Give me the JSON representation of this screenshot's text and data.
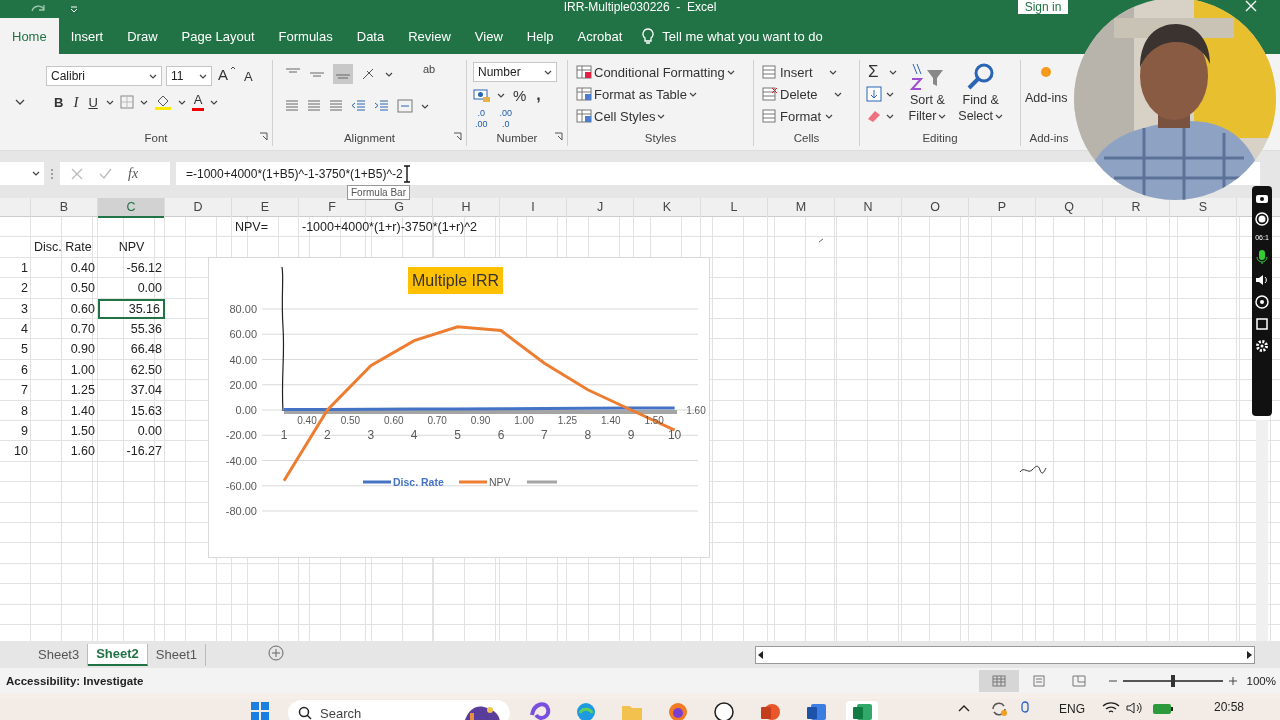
{
  "window": {
    "title": "IRR-Multiple030226  -  Excel",
    "sign_in": "Sign in"
  },
  "ribbon_tabs": [
    {
      "label": "Home",
      "selected": true
    },
    {
      "label": "Insert",
      "selected": false
    },
    {
      "label": "Draw",
      "selected": false
    },
    {
      "label": "Page Layout",
      "selected": false
    },
    {
      "label": "Formulas",
      "selected": false
    },
    {
      "label": "Data",
      "selected": false
    },
    {
      "label": "Review",
      "selected": false
    },
    {
      "label": "View",
      "selected": false
    },
    {
      "label": "Help",
      "selected": false
    },
    {
      "label": "Acrobat",
      "selected": false
    }
  ],
  "tell_me": "Tell me what you want to do",
  "ribbon": {
    "font_family": "Calibri",
    "font_size": "11",
    "grow_font": "A",
    "shrink_font": "A",
    "bold": "B",
    "italic": "I",
    "underline": "U",
    "font_color": "A",
    "wrap_text": "ab",
    "number_format": "Number",
    "percent": "%",
    "comma": ",",
    "increase_decimal": [
      ".0",
      ".00"
    ],
    "decrease_decimal": [
      ".00",
      ".0"
    ],
    "styles": [
      "Conditional Formatting",
      "Format as Table",
      "Cell Styles"
    ],
    "cells": [
      "Insert",
      "Delete",
      "Format"
    ],
    "sum": "Σ",
    "sort_filter": [
      "Sort &",
      "Filter"
    ],
    "find_select": [
      "Find &",
      "Select"
    ],
    "add_ins": "Add-ins",
    "group_labels": [
      "Font",
      "Alignment",
      "Number",
      "Styles",
      "Cells",
      "Editing",
      "Add-ins"
    ]
  },
  "formula_bar": {
    "fx": "fx",
    "formula": "=-1000+4000*(1+B5)^-1-3750*(1+B5)^-2",
    "tooltip": "Formula Bar"
  },
  "columns": [
    {
      "label": "B",
      "selected": false
    },
    {
      "label": "C",
      "selected": true
    },
    {
      "label": "D",
      "selected": false
    },
    {
      "label": "E",
      "selected": false
    },
    {
      "label": "F",
      "selected": false
    },
    {
      "label": "G",
      "selected": false
    },
    {
      "label": "H",
      "selected": false
    },
    {
      "label": "I",
      "selected": false
    },
    {
      "label": "J",
      "selected": false
    },
    {
      "label": "K",
      "selected": false
    },
    {
      "label": "L",
      "selected": false
    },
    {
      "label": "M",
      "selected": false
    },
    {
      "label": "N",
      "selected": false
    },
    {
      "label": "O",
      "selected": false
    },
    {
      "label": "P",
      "selected": false
    },
    {
      "label": "Q",
      "selected": false
    },
    {
      "label": "R",
      "selected": false
    },
    {
      "label": "S",
      "selected": false
    }
  ],
  "sheet": {
    "npv_label": "NPV=",
    "npv_formula": "-1000+4000*(1+r)-3750*(1+r)^2",
    "headers": [
      "Disc. Rate",
      "NPV"
    ],
    "rows": [
      {
        "n": "1",
        "rate": "0.40",
        "npv": "-56.12",
        "selected": false
      },
      {
        "n": "2",
        "rate": "0.50",
        "npv": "0.00",
        "selected": false
      },
      {
        "n": "3",
        "rate": "0.60",
        "npv": "35.16",
        "selected": true
      },
      {
        "n": "4",
        "rate": "0.70",
        "npv": "55.36",
        "selected": false
      },
      {
        "n": "5",
        "rate": "0.90",
        "npv": "66.48",
        "selected": false
      },
      {
        "n": "6",
        "rate": "1.00",
        "npv": "62.50",
        "selected": false
      },
      {
        "n": "7",
        "rate": "1.25",
        "npv": "37.04",
        "selected": false
      },
      {
        "n": "8",
        "rate": "1.40",
        "npv": "15.63",
        "selected": false
      },
      {
        "n": "9",
        "rate": "1.50",
        "npv": "0.00",
        "selected": false
      },
      {
        "n": "10",
        "rate": "1.60",
        "npv": "-16.27",
        "selected": false
      }
    ]
  },
  "chart": {
    "chart_data": {
      "type": "line",
      "title": "Multiple IRR",
      "categories": [
        "1",
        "2",
        "3",
        "4",
        "5",
        "6",
        "7",
        "8",
        "9",
        "10"
      ],
      "series": [
        {
          "name": "Disc. Rate",
          "color": "#4472c4",
          "values": [
            0.4,
            0.5,
            0.6,
            0.7,
            0.9,
            1.0,
            1.3,
            1.4,
            1.5,
            1.6
          ]
        },
        {
          "name": "NPV",
          "color": "#ed7d31",
          "values": [
            -56,
            0,
            35,
            55,
            66,
            63,
            37,
            16,
            0,
            -16
          ]
        }
      ],
      "grid": true,
      "legend": true,
      "value_labels": [
        "0.40",
        "0.50",
        "0.60",
        "0.70",
        "0.90",
        "1.00",
        "1.25",
        "1.40",
        "1.50",
        "1.60"
      ],
      "ylim": [
        -80,
        80
      ],
      "yticks": [
        {
          "value": 80,
          "label": "80.00"
        },
        {
          "value": 60,
          "label": "60.00"
        },
        {
          "value": 40,
          "label": "40.00"
        },
        {
          "value": 20,
          "label": "20.00"
        },
        {
          "value": 0,
          "label": "0.00"
        },
        {
          "value": -20,
          "label": "-20.00"
        },
        {
          "value": -40,
          "label": "-40.00"
        },
        {
          "value": -60,
          "label": "-60.00"
        },
        {
          "value": -80,
          "label": "-80.00"
        }
      ]
    }
  },
  "sheet_tabs": [
    {
      "label": "Sheet3",
      "selected": false
    },
    {
      "label": "Sheet2",
      "selected": true
    },
    {
      "label": "Sheet1",
      "selected": false
    }
  ],
  "status_bar": {
    "accessibility": "Accessibility: Investigate",
    "views": [
      {
        "kind": "normal",
        "selected": true
      },
      {
        "kind": "page_layout",
        "selected": false
      },
      {
        "kind": "page_break",
        "selected": false
      }
    ],
    "zoom_slider": {
      "level": 0.5
    },
    "zoom": "100%"
  },
  "recorder": {
    "timer": "06:1"
  },
  "taskbar": {
    "search": "Search",
    "apps": [
      {
        "kind": "swirl",
        "selected": false
      },
      {
        "kind": "globe",
        "selected": false
      },
      {
        "kind": "folder",
        "selected": false
      },
      {
        "kind": "fox",
        "selected": false
      },
      {
        "kind": "circle_logo",
        "selected": false
      },
      {
        "kind": "presentation",
        "selected": false
      },
      {
        "kind": "document",
        "selected": false
      },
      {
        "kind": "spreadsheet",
        "selected": true
      }
    ],
    "language": "ENG",
    "time": "20:58"
  }
}
